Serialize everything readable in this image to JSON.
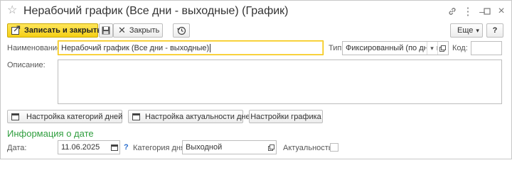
{
  "window": {
    "title": "Нерабочий график (Все дни - выходные) (График)",
    "icons": [
      "star-icon",
      "link-icon",
      "more-icon",
      "minimize-icon",
      "maximize-icon",
      "close-icon"
    ],
    "close_glyph": "×",
    "more_glyph": "⋮",
    "minimize_glyph": "–"
  },
  "toolbar": {
    "save_close_label": "Записать и закрыть",
    "close_label": "Закрыть",
    "more_label": "Еще",
    "more_arrow": "▾",
    "help_label": "?",
    "accent_color": "#f5cf16"
  },
  "form": {
    "name_label": "Наименование:",
    "name_value": "Нерабочий график (Все дни - выходные)",
    "type_label": "Тип:",
    "type_value": "Фиксированный (по дням н",
    "code_label": "Код:",
    "code_value": "",
    "description_label": "Описание:",
    "description_value": ""
  },
  "buttons": {
    "category_settings": "Настройка категорий дней",
    "relevance_settings": "Настройка актуальности дней",
    "schedule_settings": "Настройки графика"
  },
  "date_info": {
    "section_title": "Информация о дате",
    "date_label": "Дата:",
    "date_value": "11.06.2025",
    "help_mark": "?",
    "category_label": "Категория дня:",
    "category_value": "Выходной",
    "relevance_label": "Актуальность:",
    "relevance_checked": false,
    "section_color": "#2f9e3e"
  }
}
